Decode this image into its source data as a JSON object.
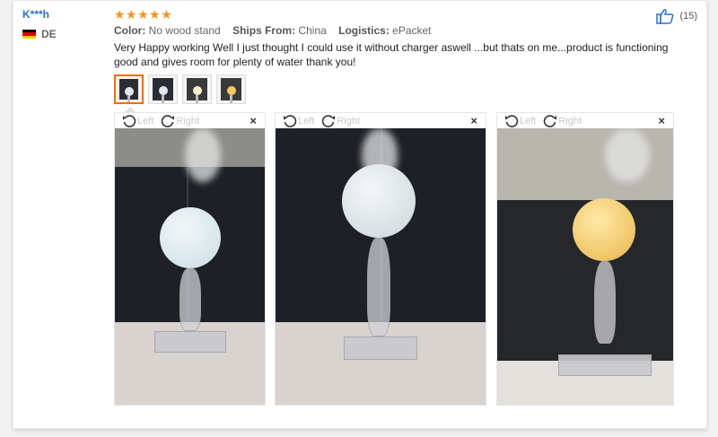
{
  "review": {
    "user_name": "K***h",
    "country_code": "DE",
    "stars": "★★★★★",
    "rating": 5,
    "meta": {
      "color_label": "Color:",
      "color_value": "No wood stand",
      "ships_label": "Ships From:",
      "ships_value": "China",
      "logistics_label": "Logistics:",
      "logistics_value": "ePacket"
    },
    "text": "Very Happy working Well I just thought I could use it without charger aswell ...but thats on me...product is functioning good and gives room for plenty of water thank you!",
    "likes": "(15)"
  },
  "viewer_controls": {
    "left_label": "Left",
    "right_label": "Right",
    "close_glyph": "×"
  },
  "colors": {
    "accent": "#ff6a00",
    "star": "#f7931e",
    "link": "#2d6ecf",
    "moon_white": "#dfe8ec",
    "moon_yellow": "#f4c867"
  },
  "icons": {
    "like": "thumbs-up-icon",
    "rotate_left": "rotate-left-icon",
    "rotate_right": "rotate-right-icon",
    "close": "close-icon",
    "flag": "germany-flag-icon"
  }
}
